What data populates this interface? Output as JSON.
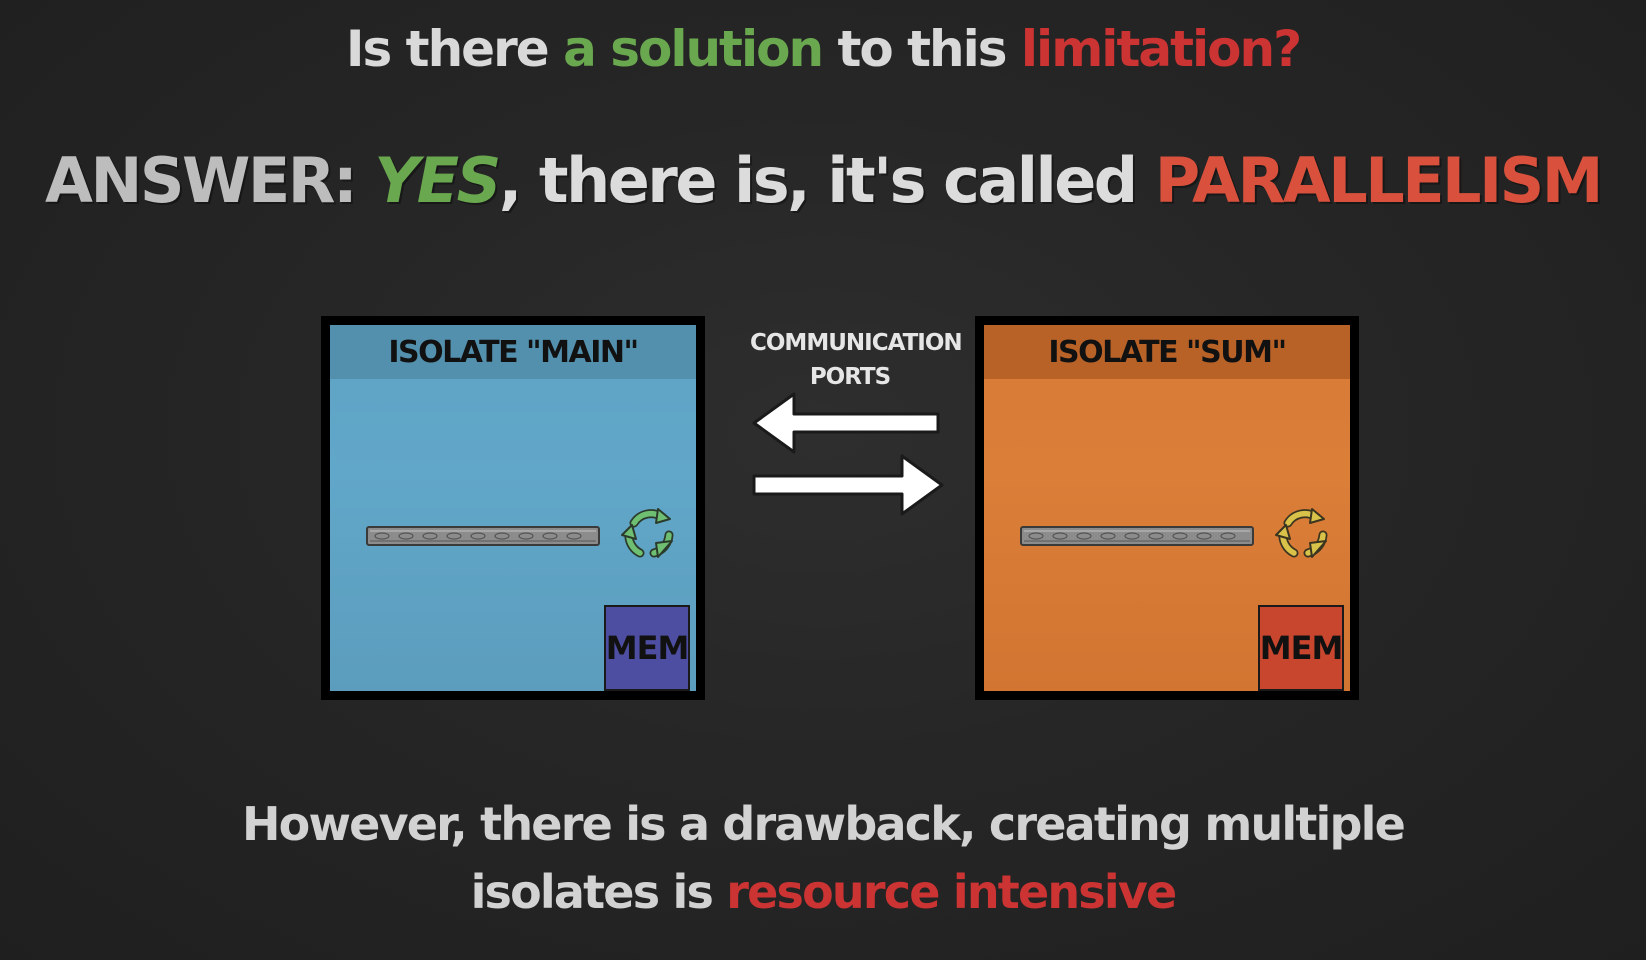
{
  "question": {
    "part1": "Is there ",
    "solution": "a solution",
    "part2": " to this ",
    "limitation": "limitation?"
  },
  "answer": {
    "prefix": "ANSWER: ",
    "yes": "YES",
    "middle": ", there is, it's called ",
    "parallelism": "PARALLELISM"
  },
  "isolates": {
    "main": {
      "title": "ISOLATE \"MAIN\"",
      "mem": "MEM",
      "color": "#61a7c9",
      "mem_color": "#4d4ea1",
      "loop_color": "#6fbf73"
    },
    "sum": {
      "title": "ISOLATE \"SUM\"",
      "mem": "MEM",
      "color": "#da7e38",
      "mem_color": "#c8452e",
      "loop_color": "#d9c24a"
    }
  },
  "ports": {
    "line1": "COMMUNICATION",
    "line2": "PORTS"
  },
  "bottom": {
    "line1": "However, there is a drawback, creating multiple",
    "line2_prefix": "isolates is ",
    "line2_highlight": "resource intensive"
  },
  "colors": {
    "green": "#6aa84f",
    "red": "#cc3333",
    "orange_red": "#d9513c",
    "background": "#262626"
  }
}
